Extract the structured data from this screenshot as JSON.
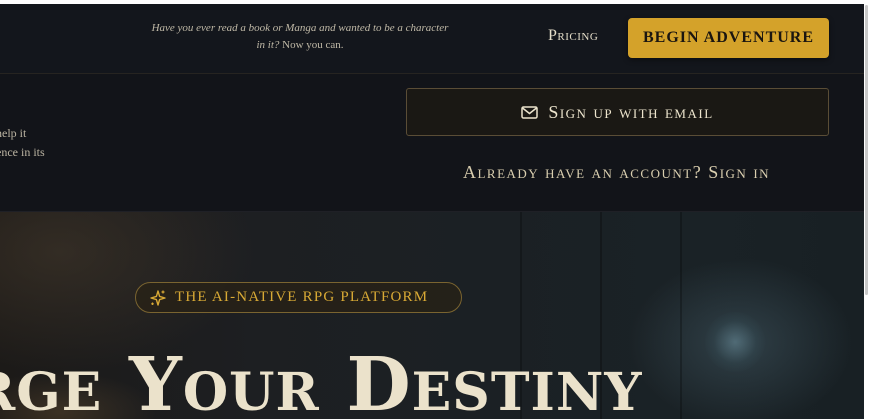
{
  "header": {
    "tagline_italic": "Have you ever read a book or Manga and wanted to be a character in it?",
    "tagline_plain": "Now you can.",
    "pricing_label": "Pricing",
    "begin_label": "BEGIN ADVENTURE"
  },
  "signup": {
    "side_text_line1": "help it",
    "side_text_line2": "ence in its",
    "email_button_label": "Sign up with email",
    "email_icon": "mail-icon",
    "signin_label": "Already have an account? Sign in"
  },
  "hero": {
    "badge_icon": "sparkles-icon",
    "badge_label": "THE AI-NATIVE RPG PLATFORM",
    "title": "rge Your Destiny"
  },
  "colors": {
    "background": "#14171d",
    "accent_gold": "#d4a22a",
    "text_cream": "#ebe2cb"
  }
}
